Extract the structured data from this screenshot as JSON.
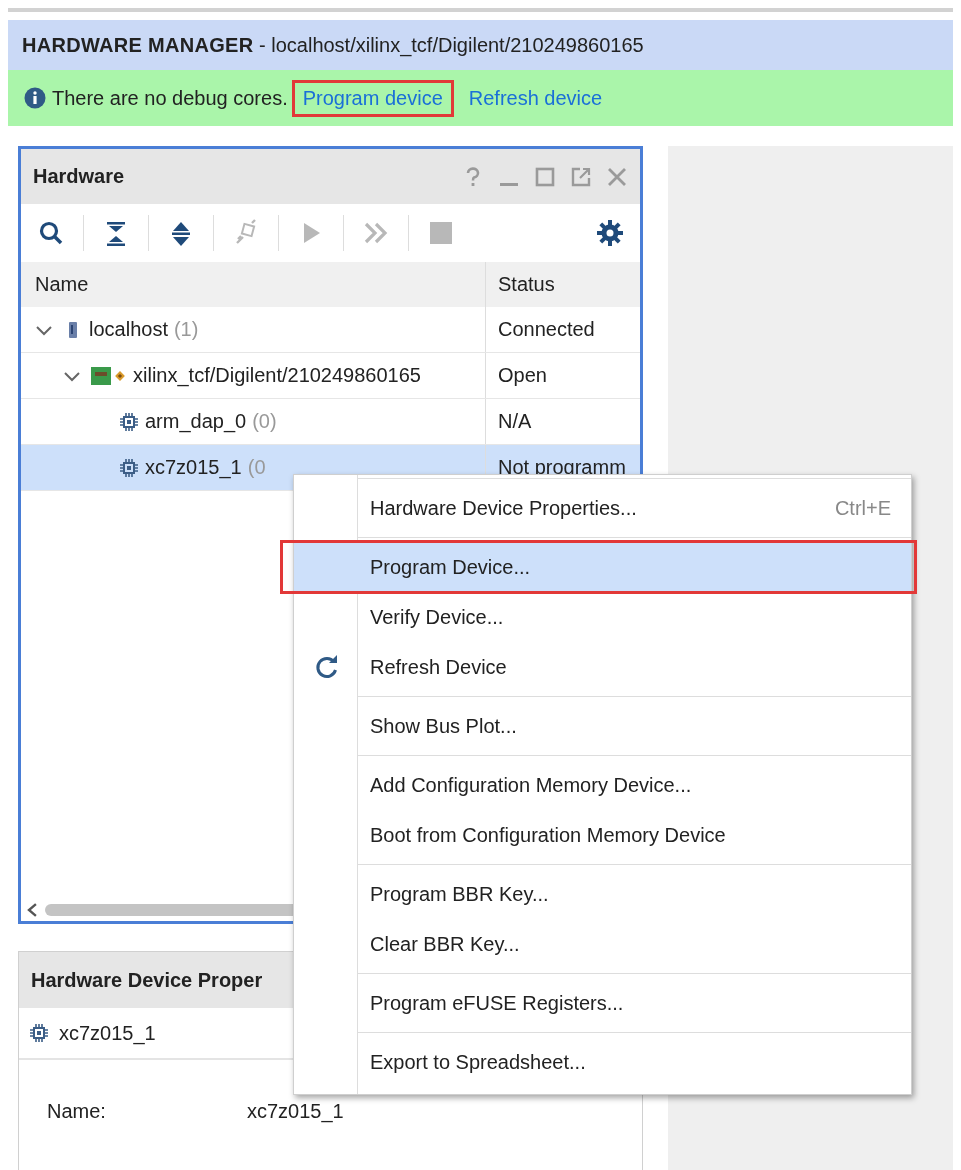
{
  "header": {
    "title": "HARDWARE MANAGER",
    "path": " - localhost/xilinx_tcf/Digilent/210249860165"
  },
  "banner": {
    "message": "There are no debug cores.",
    "links": [
      {
        "label": "Program device",
        "highlighted": true
      },
      {
        "label": "Refresh device",
        "highlighted": false
      }
    ]
  },
  "hardware_panel": {
    "title": "Hardware",
    "toolbar": [
      {
        "disabled": false
      },
      {
        "disabled": false
      },
      {
        "disabled": false
      },
      {
        "disabled": true
      },
      {
        "disabled": true
      },
      {
        "disabled": true
      },
      {
        "disabled": true
      },
      {
        "disabled": false
      }
    ],
    "columns": [
      "Name",
      "Status"
    ],
    "tree": [
      {
        "kind": "server",
        "name": "localhost",
        "count": "(1)",
        "status": "Connected",
        "expanded": true,
        "selected": false,
        "children": [
          {
            "kind": "board",
            "name": "xilinx_tcf/Digilent/210249860165",
            "status": "Open",
            "expanded": true,
            "selected": false,
            "children": [
              {
                "kind": "chip",
                "name": "arm_dap_0",
                "count": "(0)",
                "status": "N/A",
                "selected": false
              },
              {
                "kind": "chip",
                "name": "xc7z015_1",
                "count": "(0",
                "status": "Not programm",
                "selected": true
              }
            ]
          }
        ]
      }
    ]
  },
  "properties_panel": {
    "title": "Hardware Device Proper",
    "device": "xc7z015_1",
    "fields": [
      {
        "label": "Name:",
        "value": "xc7z015_1"
      }
    ]
  },
  "context_menu": {
    "groups": [
      [
        {
          "kind": "plain",
          "label": "Hardware Device Properties...",
          "shortcut": "Ctrl+E",
          "selected": false,
          "highlighted": false
        }
      ],
      [
        {
          "kind": "plain",
          "label": "Program Device...",
          "selected": true,
          "highlighted": true
        },
        {
          "kind": "plain",
          "label": "Verify Device...",
          "selected": false,
          "highlighted": false
        },
        {
          "kind": "refresh",
          "label": "Refresh Device",
          "selected": false,
          "highlighted": false
        }
      ],
      [
        {
          "kind": "plain",
          "label": "Show Bus Plot...",
          "selected": false,
          "highlighted": false
        }
      ],
      [
        {
          "kind": "plain",
          "label": "Add Configuration Memory Device...",
          "selected": false,
          "highlighted": false
        },
        {
          "kind": "plain",
          "label": "Boot from Configuration Memory Device",
          "selected": false,
          "highlighted": false
        }
      ],
      [
        {
          "kind": "plain",
          "label": "Program BBR Key...",
          "selected": false,
          "highlighted": false
        },
        {
          "kind": "plain",
          "label": "Clear BBR Key...",
          "selected": false,
          "highlighted": false
        }
      ],
      [
        {
          "kind": "plain",
          "label": "Program eFUSE Registers...",
          "selected": false,
          "highlighted": false
        }
      ],
      [
        {
          "kind": "plain",
          "label": "Export to Spreadsheet...",
          "selected": false,
          "highlighted": false
        }
      ]
    ]
  }
}
